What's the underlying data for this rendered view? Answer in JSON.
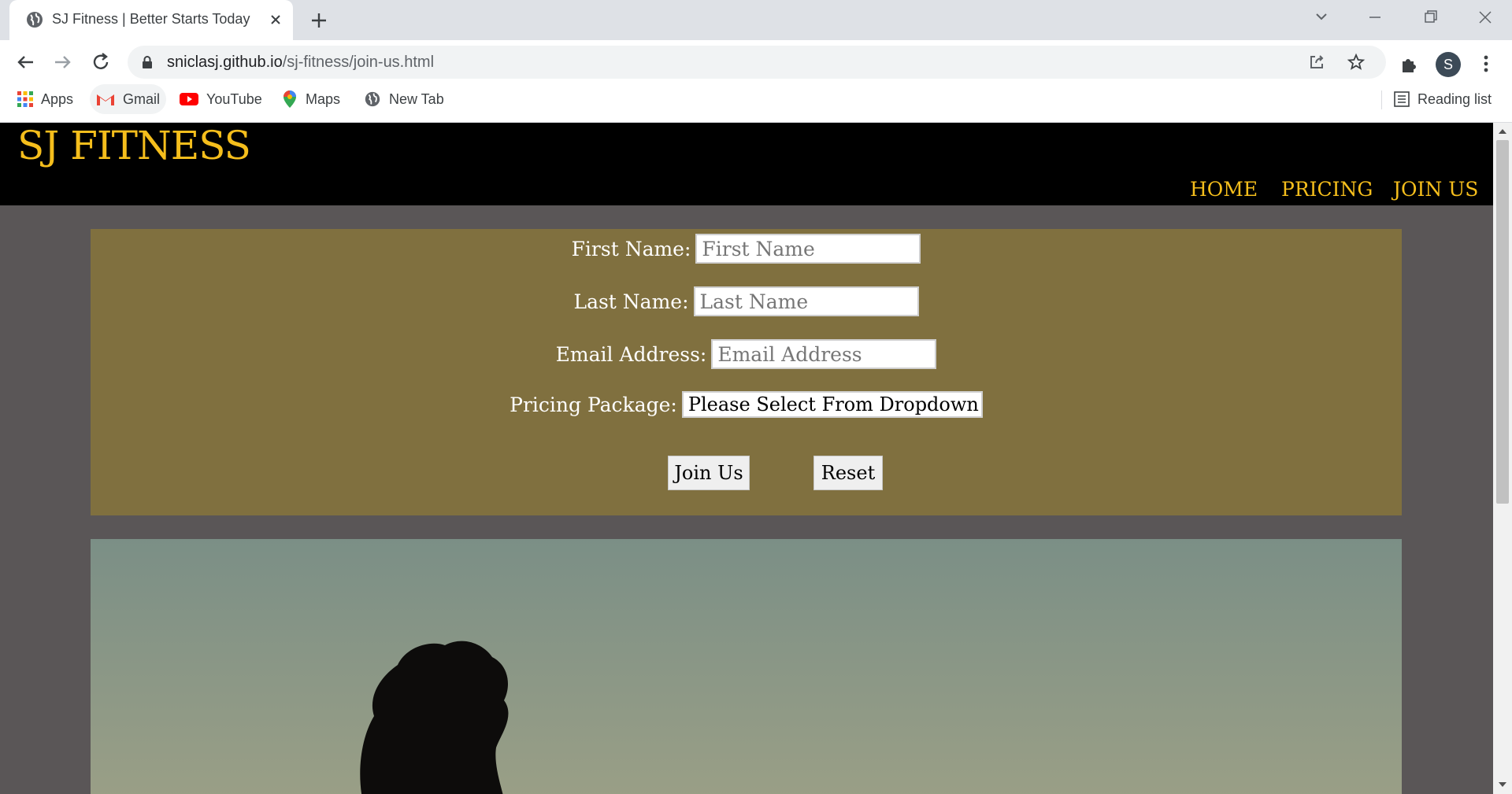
{
  "browser": {
    "tab": {
      "title": "SJ Fitness | Better Starts Today"
    },
    "address": {
      "host": "sniclasj.github.io",
      "path": "/sj-fitness/join-us.html"
    },
    "profile_initial": "S",
    "bookmarks": [
      {
        "label": "Apps",
        "icon": "apps-grid-icon"
      },
      {
        "label": "Gmail",
        "icon": "gmail-icon"
      },
      {
        "label": "YouTube",
        "icon": "youtube-icon"
      },
      {
        "label": "Maps",
        "icon": "maps-pin-icon"
      },
      {
        "label": "New Tab",
        "icon": "globe-icon"
      }
    ],
    "reading_list": "Reading list"
  },
  "site": {
    "brand": "SJ FITNESS",
    "nav": [
      "HOME",
      "PRICING",
      "JOIN US"
    ],
    "accent_color": "#f5be1c",
    "form": {
      "first_name_label": "First Name:",
      "first_name_placeholder": "First Name",
      "last_name_label": "Last Name:",
      "last_name_placeholder": "Last Name",
      "email_label": "Email Address:",
      "email_placeholder": "Email Address",
      "package_label": "Pricing Package:",
      "package_selected": "Please Select From Dropdown",
      "join_button": "Join Us",
      "reset_button": "Reset",
      "panel_color": "#80703f"
    }
  }
}
